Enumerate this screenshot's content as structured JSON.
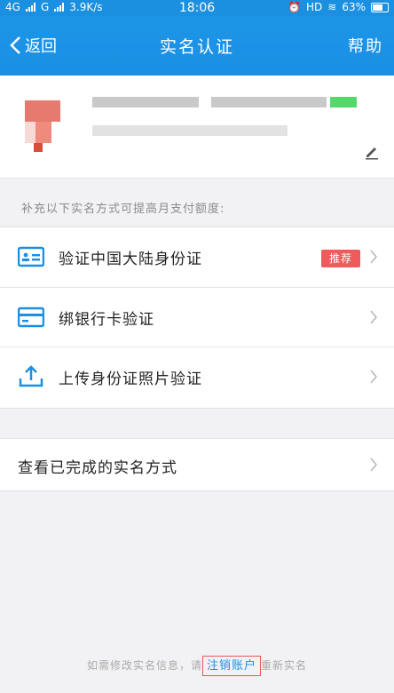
{
  "status_bar": {
    "network1": "4G",
    "network2": "G",
    "speed": "3.9K/s",
    "time": "18:06",
    "hd": "HD",
    "battery": "63%"
  },
  "app_bar": {
    "back_label": "返回",
    "title": "实名认证",
    "help_label": "帮助"
  },
  "hint": "补充以下实名方式可提高月支付额度:",
  "methods": [
    {
      "label": "验证中国大陆身份证",
      "badge": "推荐",
      "icon": "id-card-icon"
    },
    {
      "label": "绑银行卡验证",
      "icon": "bank-card-icon"
    },
    {
      "label": "上传身份证照片验证",
      "icon": "upload-icon"
    }
  ],
  "view_completed": "查看已完成的实名方式",
  "footer": {
    "prefix": "如需修改实名信息，请",
    "link": "注销账户",
    "suffix": "重新实名"
  },
  "colors": {
    "primary": "#1a8fe3",
    "badge": "#ef5b5b"
  }
}
